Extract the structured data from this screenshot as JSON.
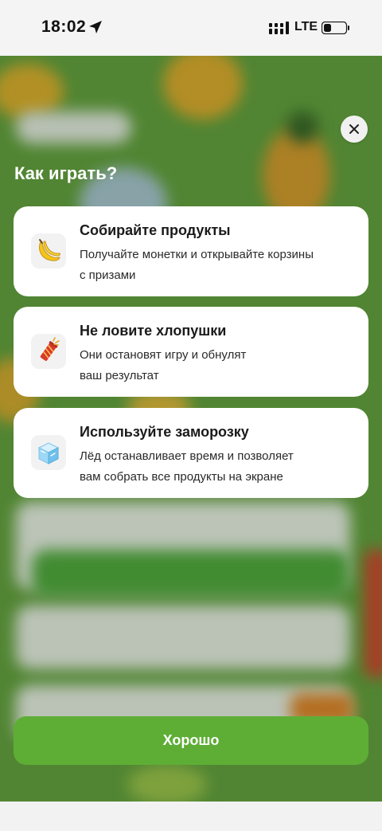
{
  "status_bar": {
    "time": "18:02",
    "network": "LTE"
  },
  "dialog": {
    "title": "Как играть?",
    "rules": [
      {
        "icon": "banana-icon",
        "title": "Собирайте продукты",
        "line1": "Получайте монетки и открывайте корзины",
        "line2": "с призами"
      },
      {
        "icon": "firecracker-icon",
        "title": "Не ловите хлопушки",
        "line1": "Они остановят игру и обнулят",
        "line2": "ваш результат"
      },
      {
        "icon": "ice-cube-icon",
        "title": "Используйте заморозку",
        "line1": "Лёд останавливает время и позволяет",
        "line2": "вам собрать все продукты на экране"
      }
    ],
    "ok_label": "Хорошо"
  }
}
